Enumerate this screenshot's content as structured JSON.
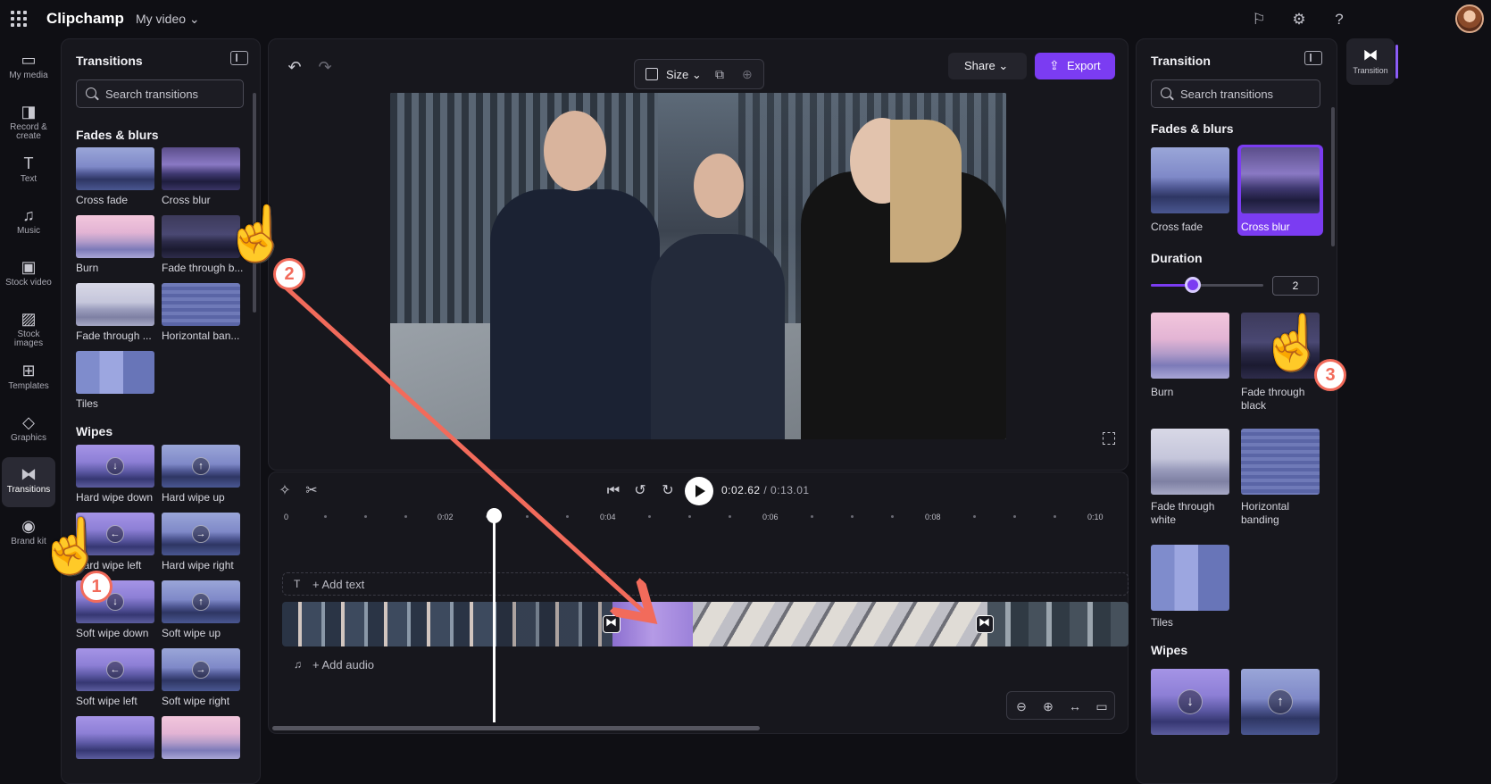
{
  "app": {
    "name": "Clipchamp",
    "project_title": "My video"
  },
  "leftnav": {
    "items": [
      {
        "label": "My media",
        "icon": "folder-icon"
      },
      {
        "label": "Record & create",
        "icon": "camera-icon"
      },
      {
        "label": "Text",
        "icon": "text-icon"
      },
      {
        "label": "Music",
        "icon": "music-icon"
      },
      {
        "label": "Stock video",
        "icon": "film-icon"
      },
      {
        "label": "Stock images",
        "icon": "image-icon"
      },
      {
        "label": "Templates",
        "icon": "templates-icon"
      },
      {
        "label": "Graphics",
        "icon": "shapes-icon"
      },
      {
        "label": "Transitions",
        "icon": "transition-icon"
      },
      {
        "label": "Brand kit",
        "icon": "brand-icon"
      }
    ]
  },
  "transitions_panel": {
    "title": "Transitions",
    "search_placeholder": "Search transitions",
    "sections": [
      {
        "title": "Fades & blurs",
        "items": [
          "Cross fade",
          "Cross blur",
          "Burn",
          "Fade through b...",
          "Fade through ...",
          "Horizontal ban...",
          "Tiles"
        ]
      },
      {
        "title": "Wipes",
        "items": [
          "Hard wipe down",
          "Hard wipe up",
          "Hard wipe left",
          "Hard wipe right",
          "Soft wipe down",
          "Soft wipe up",
          "Soft wipe left",
          "Soft wipe right"
        ]
      }
    ]
  },
  "stage": {
    "size_label": "Size",
    "share_label": "Share",
    "export_label": "Export"
  },
  "timeline": {
    "current_time": "0:02.62",
    "total_time": "/ 0:13.01",
    "ruler_labels": [
      "0",
      "0:02",
      "0:04",
      "0:06",
      "0:08",
      "0:10"
    ],
    "add_text_label": "+ Add text",
    "add_audio_label": "+ Add audio"
  },
  "properties_panel": {
    "title": "Transition",
    "search_placeholder": "Search transitions",
    "section_fades": "Fades & blurs",
    "section_wipes": "Wipes",
    "duration_label": "Duration",
    "duration_value": "2",
    "duration_fraction": 0.37,
    "items": [
      "Cross fade",
      "Cross blur",
      "Burn",
      "Fade through black",
      "Fade through white",
      "Horizontal banding",
      "Tiles"
    ],
    "selected_item": "Cross blur"
  },
  "rail": {
    "label": "Transition"
  },
  "annotations": {
    "steps": [
      "1",
      "2",
      "3"
    ]
  },
  "colors": {
    "accent": "#7b3cf2",
    "annotation": "#f26b5b"
  }
}
